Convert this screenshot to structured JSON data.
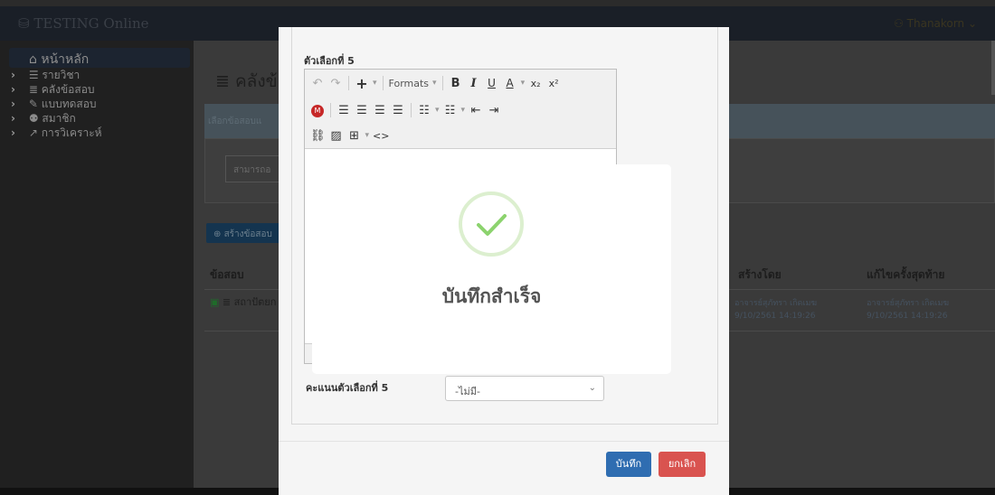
{
  "navbar": {
    "brand": "TESTING Online",
    "user": "Thanakorn"
  },
  "sidebar": {
    "home": "หน้าหลัก",
    "items": [
      {
        "label": "รายวิชา",
        "icon": "list-icon"
      },
      {
        "label": "คลังข้อสอบ",
        "icon": "database-icon"
      },
      {
        "label": "แบบทดสอบ",
        "icon": "edit-icon"
      },
      {
        "label": "สมาชิก",
        "icon": "users-icon"
      },
      {
        "label": "การวิเคราะห์",
        "icon": "chart-icon"
      }
    ]
  },
  "main": {
    "title": "คลังข้",
    "filter_label": "เลือกข้อสอบแ",
    "filter_placeholder": "สามารถอ",
    "create_button": "สร้างข้อสอบ",
    "table": {
      "headers": [
        "ข้อสอบ",
        "สร้างโดย",
        "แก้ไขครั้งสุดท้าย"
      ],
      "rows": [
        {
          "title": "สถาปัตยก",
          "created_by": "อาจารย์สุภัทรา เกิดเมฆ",
          "created_at": "9/10/2561 14:19:26",
          "updated_by": "อาจารย์สุภัทรา เกิดเมฆ",
          "updated_at": "9/10/2561 14:19:26"
        }
      ]
    }
  },
  "editor": {
    "choice_label": "ตัวเลือกที่ 5",
    "formats_label": "Formats",
    "score_label": "คะแนนตัวเลือกที่ 5",
    "score_selected": "-ไม่มี-",
    "save_button": "บันทึก",
    "cancel_button": "ยกเลิก"
  },
  "success_dialog": {
    "message": "บันทึกสำเร็จ",
    "check_color": "#8cd36e",
    "ring_color": "#dcefcf"
  }
}
